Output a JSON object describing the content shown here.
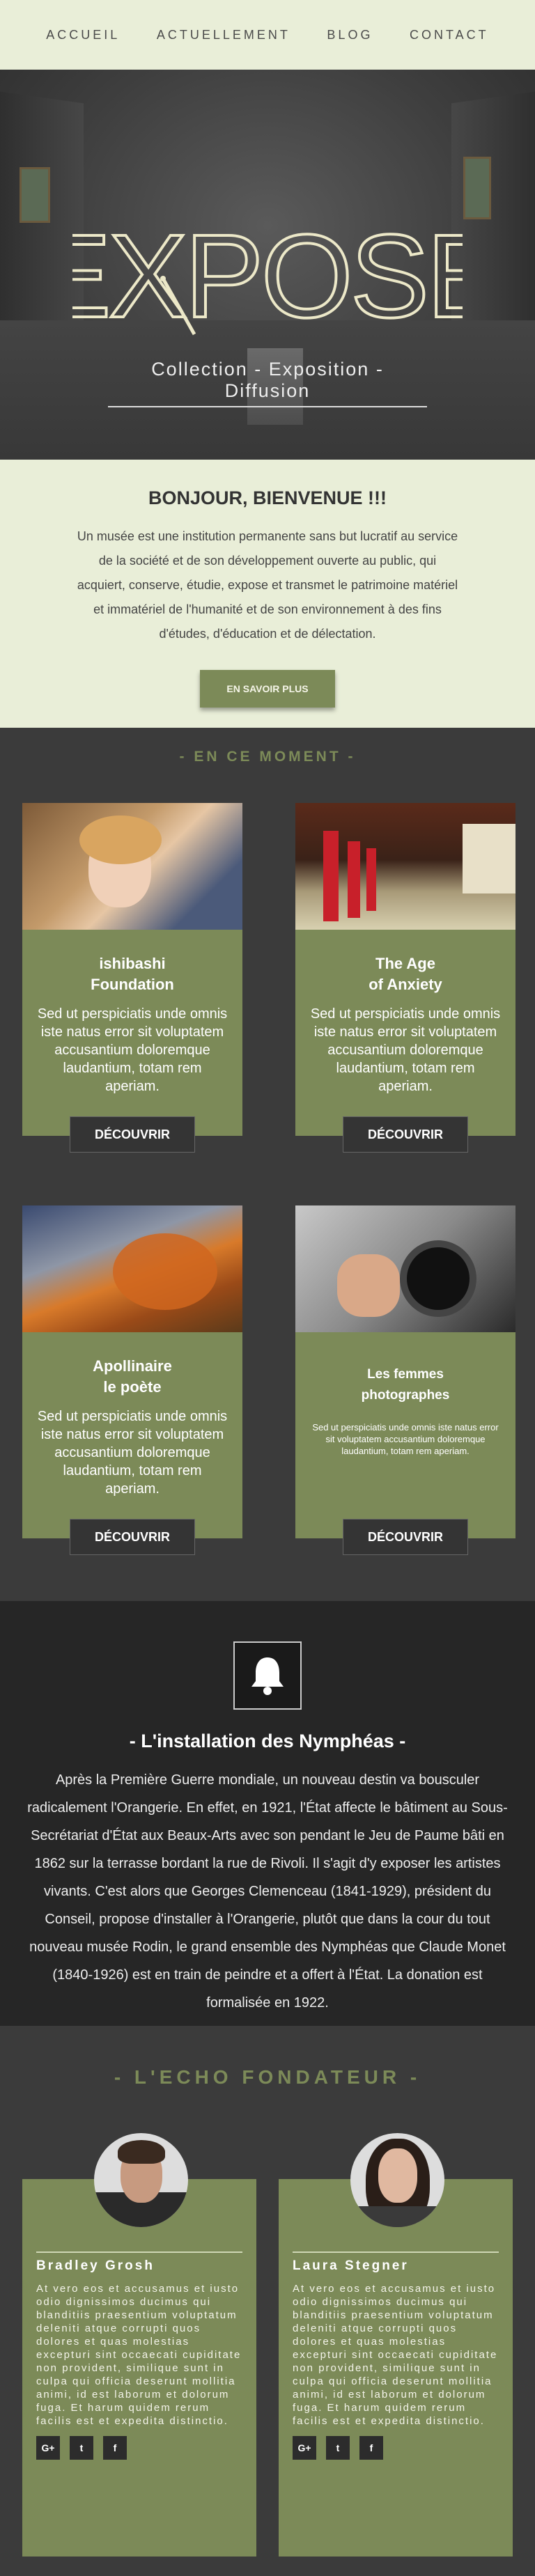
{
  "nav": {
    "items": [
      "ACCUEIL",
      "ACTUELLEMENT",
      "BLOG",
      "CONTACT"
    ]
  },
  "hero": {
    "logo": "EXPOSE",
    "tagline": "Collection - Exposition - Diffusion"
  },
  "welcome": {
    "title": "BONJOUR, BIENVENUE !!!",
    "text": "Un musée est une institution permanente sans but lucratif au service de la société et de son développement ouverte au public, qui acquiert, conserve, étudie, expose et transmet le patrimoine matériel et immatériel de l'humanité et de son environnement à des fins d'études, d'éducation et de délectation.",
    "button": "EN SAVOIR PLUS"
  },
  "moment": {
    "title": "- EN CE MOMENT -",
    "cards": [
      {
        "title": "ishibashi\nFoundation",
        "text": "Sed ut perspiciatis unde omnis iste natus error sit voluptatem accusantium doloremque laudantium, totam rem aperiam.",
        "button": "DÉCOUVRIR"
      },
      {
        "title": "The Age\nof Anxiety",
        "text": "Sed ut perspiciatis unde omnis iste natus error sit voluptatem accusantium doloremque laudantium, totam rem aperiam.",
        "button": "DÉCOUVRIR"
      },
      {
        "title": "Apollinaire\nle poète",
        "text": "Sed ut perspiciatis unde omnis iste natus error sit voluptatem accusantium doloremque laudantium, totam rem aperiam.",
        "button": "DÉCOUVRIR"
      },
      {
        "title": "Les femmes\nphotographes",
        "text": "Sed ut perspiciatis unde omnis iste natus error sit voluptatem accusantium doloremque laudantium, totam rem aperiam.",
        "button": "DÉCOUVRIR"
      }
    ]
  },
  "nymph": {
    "title": "- L'installation des Nymphéas -",
    "text": "Après la Première Guerre mondiale, un nouveau destin va bousculer radicalement l'Orangerie. En effet, en 1921, l'État affecte le bâtiment au Sous-Secrétariat d'État aux Beaux-Arts avec son pendant le Jeu de Paume bâti en 1862 sur la terrasse bordant la rue de Rivoli. Il s'agit d'y exposer les artistes vivants. C'est alors que Georges Clemenceau (1841-1929), président du Conseil, propose d'installer à l'Orangerie, plutôt que dans la cour du tout nouveau musée Rodin, le grand ensemble des Nymphéas que Claude Monet (1840-1926) est en train de peindre et a offert à l'État. La donation est formalisée en 1922."
  },
  "echo": {
    "title": "- L'ECHO FONDATEUR -",
    "people": [
      {
        "name": "Bradley Grosh",
        "text": "At vero eos et accusamus et iusto odio dignissimos ducimus qui blanditiis praesentium voluptatum deleniti atque corrupti quos dolores et quas molestias excepturi sint occaecati cupiditate non provident, similique sunt in culpa qui officia deserunt mollitia animi, id est laborum et dolorum fuga. Et harum quidem rerum facilis est et expedita distinctio.",
        "socials": [
          "G+",
          "t",
          "f"
        ]
      },
      {
        "name": "Laura Stegner",
        "text": "At vero eos et accusamus et iusto odio dignissimos ducimus qui blanditiis praesentium voluptatum deleniti atque corrupti quos dolores et quas molestias excepturi sint occaecati cupiditate non provident, similique sunt in culpa qui officia deserunt mollitia animi, id est laborum et dolorum fuga. Et harum quidem rerum facilis est et expedita distinctio.",
        "socials": [
          "G+",
          "t",
          "f"
        ]
      }
    ]
  },
  "colors": {
    "accent": "#7c8a58",
    "light": "#e9eed8",
    "dark": "#3b3b3b"
  }
}
